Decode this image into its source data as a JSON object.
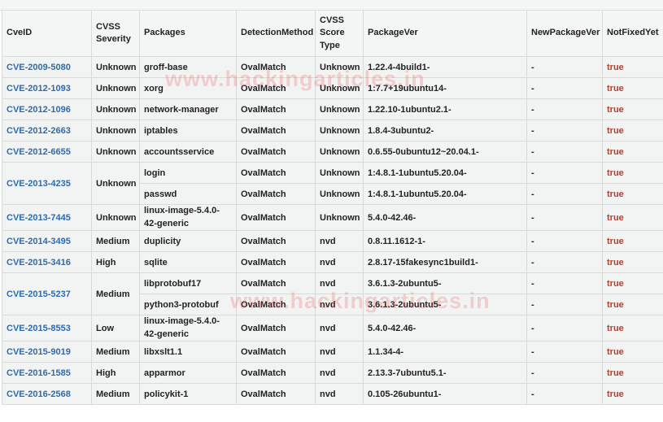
{
  "watermark": "www.hackingarticles.in",
  "columns": [
    "CveID",
    "CVSS Severity",
    "Packages",
    "DetectionMethod",
    "CVSS Score Type",
    "PackageVer",
    "NewPackageVer",
    "NotFixedYet"
  ],
  "rows": [
    {
      "cve": "CVE-2009-5080",
      "severity": "Unknown",
      "package": "groff-base",
      "method": "OvalMatch",
      "score": "Unknown",
      "ver": "1.22.4-4build1-",
      "newver": "-",
      "notfixed": "true"
    },
    {
      "cve": "CVE-2012-1093",
      "severity": "Unknown",
      "package": "xorg",
      "method": "OvalMatch",
      "score": "Unknown",
      "ver": "1:7.7+19ubuntu14-",
      "newver": "-",
      "notfixed": "true"
    },
    {
      "cve": "CVE-2012-1096",
      "severity": "Unknown",
      "package": "network-manager",
      "method": "OvalMatch",
      "score": "Unknown",
      "ver": "1.22.10-1ubuntu2.1-",
      "newver": "-",
      "notfixed": "true"
    },
    {
      "cve": "CVE-2012-2663",
      "severity": "Unknown",
      "package": "iptables",
      "method": "OvalMatch",
      "score": "Unknown",
      "ver": "1.8.4-3ubuntu2-",
      "newver": "-",
      "notfixed": "true"
    },
    {
      "cve": "CVE-2012-6655",
      "severity": "Unknown",
      "package": "accountsservice",
      "method": "OvalMatch",
      "score": "Unknown",
      "ver": "0.6.55-0ubuntu12~20.04.1-",
      "newver": "-",
      "notfixed": "true"
    },
    {
      "cve": "CVE-2013-4235",
      "severity": "Unknown",
      "package": "login",
      "method": "OvalMatch",
      "score": "Unknown",
      "ver": "1:4.8.1-1ubuntu5.20.04-",
      "newver": "-",
      "notfixed": "true"
    },
    {
      "package": "passwd",
      "method": "OvalMatch",
      "score": "Unknown",
      "ver": "1:4.8.1-1ubuntu5.20.04-",
      "newver": "-",
      "notfixed": "true"
    },
    {
      "cve": "CVE-2013-7445",
      "severity": "Unknown",
      "package": "linux-image-5.4.0-42-generic",
      "method": "OvalMatch",
      "score": "Unknown",
      "ver": "5.4.0-42.46-",
      "newver": "-",
      "notfixed": "true"
    },
    {
      "cve": "CVE-2014-3495",
      "severity": "Medium",
      "package": "duplicity",
      "method": "OvalMatch",
      "score": "nvd",
      "ver": "0.8.11.1612-1-",
      "newver": "-",
      "notfixed": "true"
    },
    {
      "cve": "CVE-2015-3416",
      "severity": "High",
      "package": "sqlite",
      "method": "OvalMatch",
      "score": "nvd",
      "ver": "2.8.17-15fakesync1build1-",
      "newver": "-",
      "notfixed": "true"
    },
    {
      "cve": "CVE-2015-5237",
      "severity": "Medium",
      "package": "libprotobuf17",
      "method": "OvalMatch",
      "score": "nvd",
      "ver": "3.6.1.3-2ubuntu5-",
      "newver": "-",
      "notfixed": "true"
    },
    {
      "package": "python3-protobuf",
      "method": "OvalMatch",
      "score": "nvd",
      "ver": "3.6.1.3-2ubuntu5-",
      "newver": "-",
      "notfixed": "true"
    },
    {
      "cve": "CVE-2015-8553",
      "severity": "Low",
      "package": "linux-image-5.4.0-42-generic",
      "method": "OvalMatch",
      "score": "nvd",
      "ver": "5.4.0-42.46-",
      "newver": "-",
      "notfixed": "true"
    },
    {
      "cve": "CVE-2015-9019",
      "severity": "Medium",
      "package": "libxslt1.1",
      "method": "OvalMatch",
      "score": "nvd",
      "ver": "1.1.34-4-",
      "newver": "-",
      "notfixed": "true"
    },
    {
      "cve": "CVE-2016-1585",
      "severity": "High",
      "package": "apparmor",
      "method": "OvalMatch",
      "score": "nvd",
      "ver": "2.13.3-7ubuntu5.1-",
      "newver": "-",
      "notfixed": "true"
    },
    {
      "cve": "CVE-2016-2568",
      "severity": "Medium",
      "package": "policykit-1",
      "method": "OvalMatch",
      "score": "nvd",
      "ver": "0.105-26ubuntu1-",
      "newver": "-",
      "notfixed": "true"
    }
  ]
}
